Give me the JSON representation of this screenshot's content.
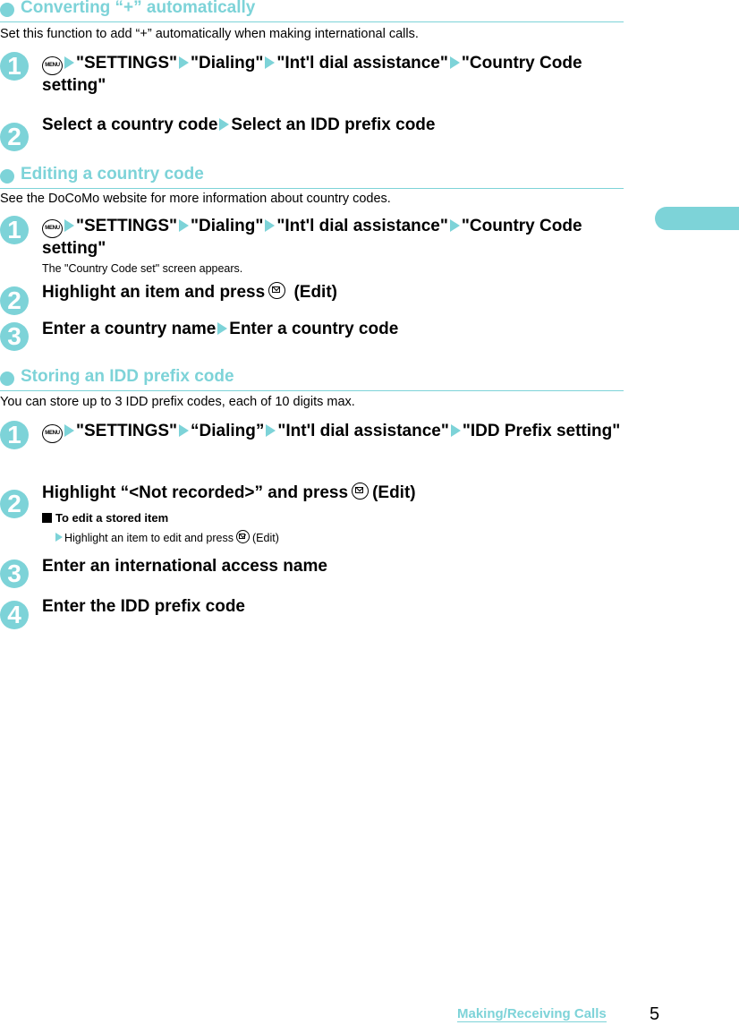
{
  "sections": [
    {
      "title": "Converting “+” automatically",
      "intro": "Set this function to add “+” automatically when making international calls.",
      "steps": [
        {
          "num": "1",
          "parts": [
            "\"SETTINGS\"",
            "\"Dialing\"",
            "\"Int'l dial assistance\"",
            "\"Country Code setting\""
          ]
        },
        {
          "num": "2",
          "parts": [
            "Select a country code",
            "Select an IDD prefix code"
          ]
        }
      ]
    },
    {
      "title": "Editing a country code",
      "intro": "See the DoCoMo website for more information about country codes.",
      "steps": [
        {
          "num": "1",
          "parts": [
            "\"SETTINGS\"",
            "\"Dialing\"",
            "\"Int'l dial assistance\"",
            "\"Country Code setting\""
          ],
          "note": "The \"Country Code set\" screen appears."
        },
        {
          "num": "2",
          "text_before": "Highlight an item and press",
          "text_after": "(Edit)"
        },
        {
          "num": "3",
          "parts": [
            "Enter a country name",
            "Enter a country code"
          ]
        }
      ]
    },
    {
      "title": "Storing an IDD prefix code",
      "intro": "You can store up to 3 IDD prefix codes, each of 10 digits max.",
      "steps": [
        {
          "num": "1",
          "parts": [
            "\"SETTINGS\"",
            "“Dialing”",
            "\"Int'l dial assistance\"",
            "\"IDD Prefix setting\""
          ]
        },
        {
          "num": "2",
          "text_before": "Highlight “<Not recorded>” and press",
          "text_after": "(Edit)",
          "sub_heading": "To edit a stored item",
          "sub_text_before": "Highlight an item to edit and press",
          "sub_text_after": "(Edit)"
        },
        {
          "num": "3",
          "text": "Enter an international access name"
        },
        {
          "num": "4",
          "text": "Enter the IDD prefix code"
        }
      ]
    }
  ],
  "keys": {
    "menu": "MENU"
  },
  "footer": {
    "chapter": "Making/Receiving Calls",
    "page": "5"
  },
  "colors": {
    "accent": "#7dd3d8"
  }
}
